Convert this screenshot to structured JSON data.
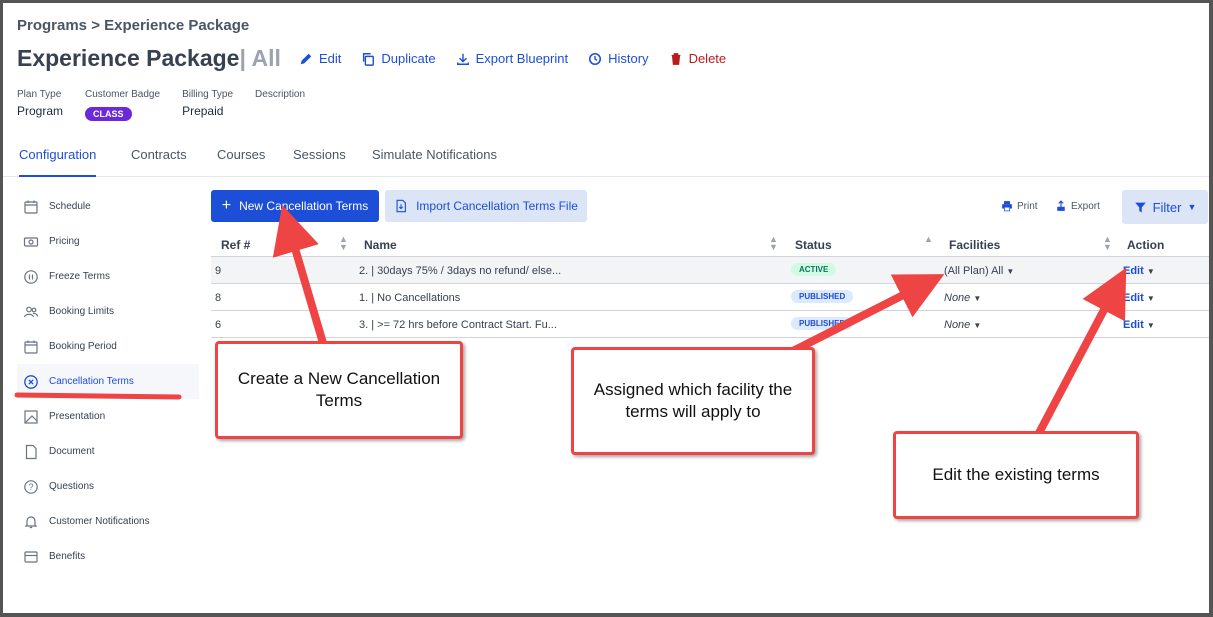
{
  "breadcrumb": "Programs > Experience Package",
  "title": {
    "name": "Experience Package",
    "scope": "| All"
  },
  "actions": {
    "edit": "Edit",
    "duplicate": "Duplicate",
    "export": "Export Blueprint",
    "history": "History",
    "delete": "Delete"
  },
  "meta": {
    "plan_type_label": "Plan Type",
    "plan_type": "Program",
    "badge_label": "Customer Badge",
    "badge": "CLASS",
    "billing_label": "Billing Type",
    "billing": "Prepaid",
    "description_label": "Description"
  },
  "tabs": [
    "Configuration",
    "Contracts",
    "Courses",
    "Sessions",
    "Simulate Notifications"
  ],
  "sidebar": [
    "Schedule",
    "Pricing",
    "Freeze Terms",
    "Booking Limits",
    "Booking Period",
    "Cancellation Terms",
    "Presentation",
    "Document",
    "Questions",
    "Customer Notifications",
    "Benefits"
  ],
  "toolbar": {
    "new_label": "New Cancellation Terms",
    "import_label": "Import Cancellation Terms File",
    "print": "Print",
    "export": "Export",
    "filter": "Filter"
  },
  "table": {
    "headers": {
      "ref": "Ref #",
      "name": "Name",
      "status": "Status",
      "facilities": "Facilities",
      "action": "Action"
    },
    "rows": [
      {
        "ref": "9",
        "name": "2. | 30days 75% / 3days no refund/ else...",
        "status": "ACTIVE",
        "facilities": "(All Plan) All",
        "action": "Edit"
      },
      {
        "ref": "8",
        "name": "1. | No Cancellations",
        "status": "PUBLISHED",
        "facilities": "None",
        "action": "Edit"
      },
      {
        "ref": "6",
        "name": "3. | >= 72 hrs before Contract Start. Fu...",
        "status": "PUBLISHED",
        "facilities": "None",
        "action": "Edit"
      }
    ]
  },
  "callouts": {
    "create": "Create a New Cancellation Terms",
    "assign": "Assigned which facility the terms will apply to",
    "edit": "Edit the existing terms"
  },
  "colors": {
    "accent": "#1d4ed8",
    "callout_red": "#ef4444",
    "badge_purple": "#6d28d9"
  }
}
